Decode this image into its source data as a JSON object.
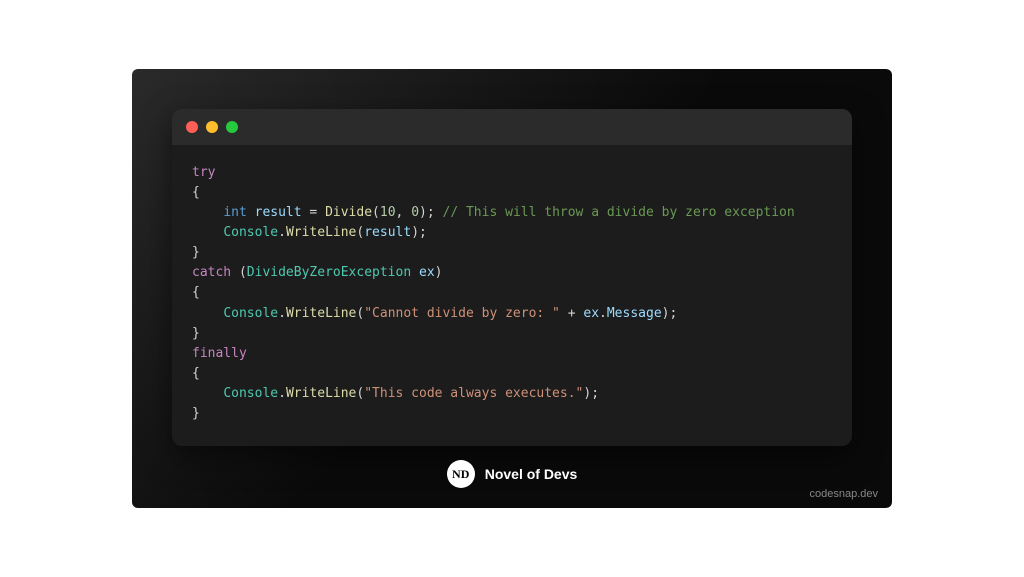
{
  "code": {
    "line1_try": "try",
    "line2_brace": "{",
    "line3_indent": "    ",
    "line3_type": "int",
    "line3_var": " result ",
    "line3_eq": "= ",
    "line3_func": "Divide",
    "line3_open": "(",
    "line3_arg1": "10",
    "line3_comma": ", ",
    "line3_arg2": "0",
    "line3_close": "); ",
    "line3_comment": "// This will throw a divide by zero exception",
    "line4_indent": "    ",
    "line4_cls": "Console",
    "line4_dot": ".",
    "line4_func": "WriteLine",
    "line4_open": "(",
    "line4_arg": "result",
    "line4_close": ");",
    "line5_brace": "}",
    "line6_catch": "catch",
    "line6_sp": " (",
    "line6_cls": "DivideByZeroException",
    "line6_var": " ex",
    "line6_close": ")",
    "line7_brace": "{",
    "line8_indent": "    ",
    "line8_cls": "Console",
    "line8_dot": ".",
    "line8_func": "WriteLine",
    "line8_open": "(",
    "line8_str": "\"Cannot divide by zero: \"",
    "line8_plus": " + ",
    "line8_ex": "ex",
    "line8_dot2": ".",
    "line8_msg": "Message",
    "line8_close": ");",
    "line9_brace": "}",
    "line10_finally": "finally",
    "line11_brace": "{",
    "line12_indent": "    ",
    "line12_cls": "Console",
    "line12_dot": ".",
    "line12_func": "WriteLine",
    "line12_open": "(",
    "line12_str": "\"This code always executes.\"",
    "line12_close": ");",
    "line13_brace": "}"
  },
  "brand": {
    "logo_text": "ND",
    "name": "Novel of Devs"
  },
  "watermark": "codesnap.dev"
}
